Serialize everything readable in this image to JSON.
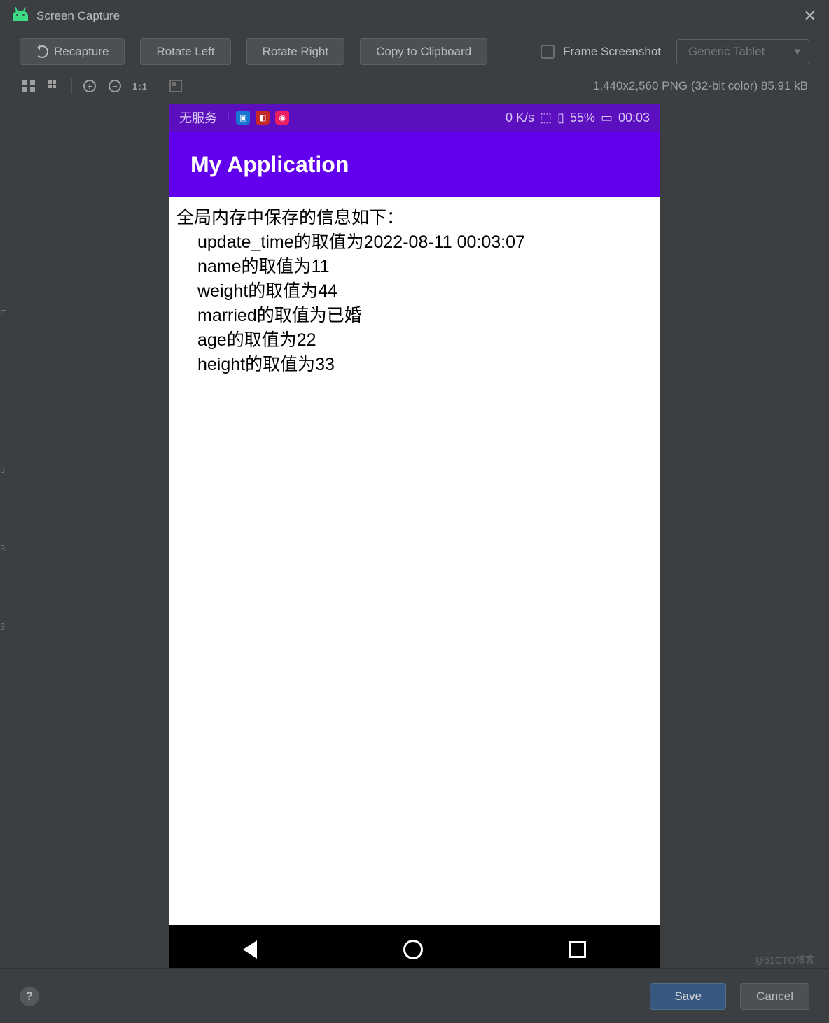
{
  "window": {
    "title": "Screen Capture"
  },
  "toolbar": {
    "recapture": "Recapture",
    "rotate_left": "Rotate Left",
    "rotate_right": "Rotate Right",
    "copy_clipboard": "Copy to Clipboard",
    "frame_screenshot": "Frame Screenshot",
    "device_combo": "Generic Tablet"
  },
  "iconbar": {
    "zoom_in": "+",
    "zoom_out": "−",
    "one_to_one": "1:1",
    "info": "1,440x2,560 PNG (32-bit color) 85.91 kB"
  },
  "phone": {
    "status": {
      "carrier": "无服务",
      "net_speed": "0 K/s",
      "battery": "55%",
      "time": "00:03"
    },
    "app_title": "My Application",
    "content": {
      "header": "全局内存中保存的信息如下：",
      "lines": [
        "update_time的取值为2022-08-11 00:03:07",
        "name的取值为11",
        "weight的取值为44",
        "married的取值为已婚",
        "age的取值为22",
        "height的取值为33"
      ]
    }
  },
  "bottom": {
    "help": "?",
    "save": "Save",
    "cancel": "Cancel"
  },
  "watermark": "@51CTO博客"
}
